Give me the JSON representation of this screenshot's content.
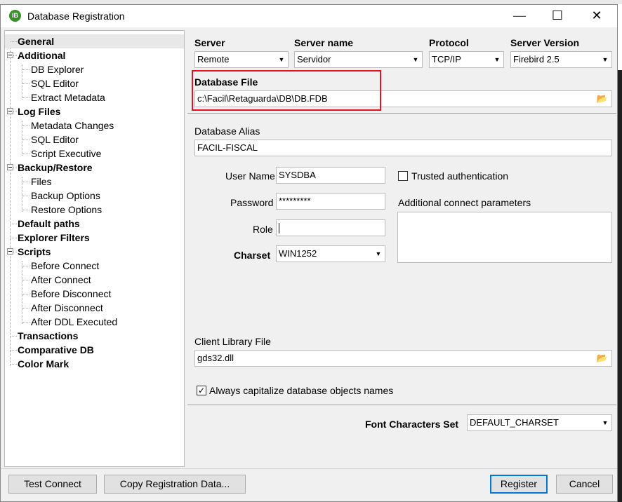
{
  "window": {
    "title": "Database Registration",
    "icon_text": "IB"
  },
  "tree": {
    "items": [
      {
        "label": "General",
        "bold": true
      },
      {
        "label": "Additional",
        "bold": true
      },
      {
        "label": "DB Explorer",
        "bold": false
      },
      {
        "label": "SQL Editor",
        "bold": false
      },
      {
        "label": "Extract Metadata",
        "bold": false
      },
      {
        "label": "Log Files",
        "bold": true
      },
      {
        "label": "Metadata Changes",
        "bold": false
      },
      {
        "label": "SQL Editor",
        "bold": false
      },
      {
        "label": "Script Executive",
        "bold": false
      },
      {
        "label": "Backup/Restore",
        "bold": true
      },
      {
        "label": "Files",
        "bold": false
      },
      {
        "label": "Backup Options",
        "bold": false
      },
      {
        "label": "Restore Options",
        "bold": false
      },
      {
        "label": "Default paths",
        "bold": true
      },
      {
        "label": "Explorer Filters",
        "bold": true
      },
      {
        "label": "Scripts",
        "bold": true
      },
      {
        "label": "Before Connect",
        "bold": false
      },
      {
        "label": "After Connect",
        "bold": false
      },
      {
        "label": "Before Disconnect",
        "bold": false
      },
      {
        "label": "After Disconnect",
        "bold": false
      },
      {
        "label": "After DDL Executed",
        "bold": false
      },
      {
        "label": "Transactions",
        "bold": true
      },
      {
        "label": "Comparative DB",
        "bold": true
      },
      {
        "label": "Color Mark",
        "bold": true
      }
    ]
  },
  "server": {
    "server_label": "Server",
    "server_value": "Remote",
    "server_name_label": "Server name",
    "server_name_value": "Servidor",
    "protocol_label": "Protocol",
    "protocol_value": "TCP/IP",
    "version_label": "Server Version",
    "version_value": "Firebird 2.5"
  },
  "database_file": {
    "label": "Database File",
    "value": "c:\\Facil\\Retaguarda\\DB\\DB.FDB"
  },
  "alias": {
    "label": "Database Alias",
    "value": "FACIL-FISCAL"
  },
  "credentials": {
    "user_label": "User Name",
    "user_value": "SYSDBA",
    "password_label": "Password",
    "password_value": "*********",
    "role_label": "Role",
    "role_value": "",
    "charset_label": "Charset",
    "charset_value": "WIN1252",
    "trusted_label": "Trusted authentication",
    "trusted_checked": false,
    "params_label": "Additional connect parameters"
  },
  "client_library": {
    "label": "Client Library File",
    "value": "gds32.dll"
  },
  "capitalize": {
    "label": "Always capitalize database objects names",
    "checked": true
  },
  "font_charset": {
    "label": "Font Characters Set",
    "value": "DEFAULT_CHARSET"
  },
  "buttons": {
    "test_connect": "Test Connect",
    "copy_registration": "Copy Registration Data...",
    "register": "Register",
    "cancel": "Cancel"
  },
  "colors": {
    "highlight": "#e81123",
    "default_button": "#0078d7"
  }
}
